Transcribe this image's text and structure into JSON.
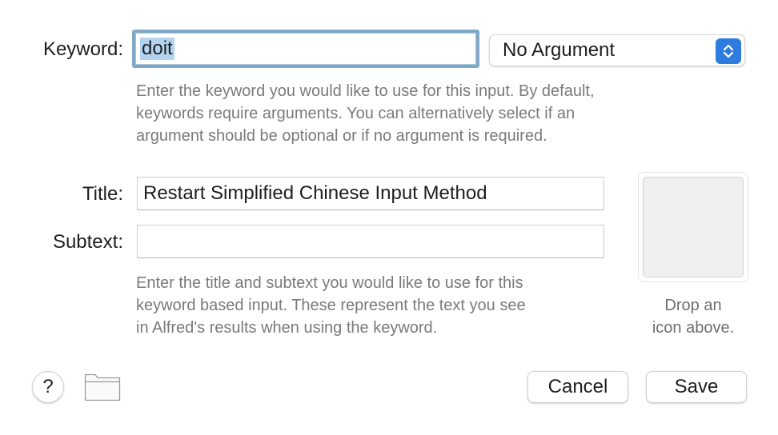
{
  "keyword": {
    "label": "Keyword:",
    "value": "doit",
    "argument_mode": "No Argument",
    "help": [
      "Enter the keyword you would like to use for this input. By default,",
      "keywords require arguments. You can alternatively select if an",
      "argument should be optional or if no argument is required."
    ]
  },
  "title": {
    "label": "Title:",
    "value": "Restart Simplified Chinese Input Method"
  },
  "subtext": {
    "label": "Subtext:",
    "value": "",
    "help": [
      "Enter the title and subtext you would like to use for this",
      "keyword based input. These represent the text you see",
      "in Alfred's results when using the keyword."
    ]
  },
  "icon_well": {
    "caption": [
      "Drop an",
      "icon above."
    ]
  },
  "footer": {
    "help_label": "?",
    "folder_icon": "folder-icon",
    "cancel_label": "Cancel",
    "save_label": "Save"
  },
  "colors": {
    "focus_ring": "#7fa8c6",
    "selection": "#b3d4f1",
    "popup_accent": "#2f7ce0",
    "help_text": "#7a7a7a"
  }
}
